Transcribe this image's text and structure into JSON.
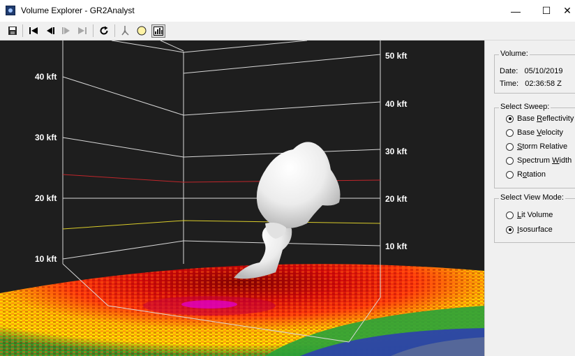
{
  "window": {
    "title": "Volume Explorer - GR2Analyst",
    "minimize": "—",
    "maximize": "☐",
    "close": "✕"
  },
  "toolbar": {
    "items": [
      {
        "icon": "save-icon"
      },
      {
        "icon": "first-frame-icon"
      },
      {
        "icon": "step-back-icon"
      },
      {
        "icon": "step-forward-icon"
      },
      {
        "icon": "last-frame-icon"
      },
      {
        "icon": "refresh-icon"
      },
      {
        "icon": "probe-icon"
      },
      {
        "icon": "light-bulb-icon"
      },
      {
        "icon": "chart-toggle-icon"
      }
    ]
  },
  "view": {
    "left_axis_labels": [
      "40 kft",
      "30 kft",
      "20 kft",
      "10 kft"
    ],
    "right_axis_labels": [
      "50 kft",
      "40 kft",
      "30 kft",
      "20 kft",
      "10 kft"
    ],
    "colors": {
      "background": "#1e1e1e",
      "grid": "#d8d8d8",
      "freezing_line": "#c0262b",
      "minus20_line": "#d9cc2a",
      "isosurface": "#f2f2f2"
    }
  },
  "panel": {
    "volume": {
      "title": "Volume:",
      "date_label": "Date:",
      "date": "05/10/2019",
      "time_label": "Time:",
      "time": "02:36:58 Z"
    },
    "sweep": {
      "title": "Select Sweep:",
      "options": [
        {
          "pre": "Base ",
          "u": "R",
          "post": "eflectivity",
          "selected": true
        },
        {
          "pre": "Base ",
          "u": "V",
          "post": "elocity",
          "selected": false
        },
        {
          "pre": "",
          "u": "S",
          "post": "torm Relative",
          "selected": false
        },
        {
          "pre": "Spectrum ",
          "u": "W",
          "post": "idth",
          "selected": false
        },
        {
          "pre": "R",
          "u": "o",
          "post": "tation",
          "selected": false
        }
      ]
    },
    "view_mode": {
      "title": "Select View Mode:",
      "options": [
        {
          "pre": "",
          "u": "L",
          "post": "it Volume",
          "selected": false
        },
        {
          "pre": "",
          "u": "I",
          "post": "sosurface",
          "selected": true
        }
      ]
    }
  }
}
